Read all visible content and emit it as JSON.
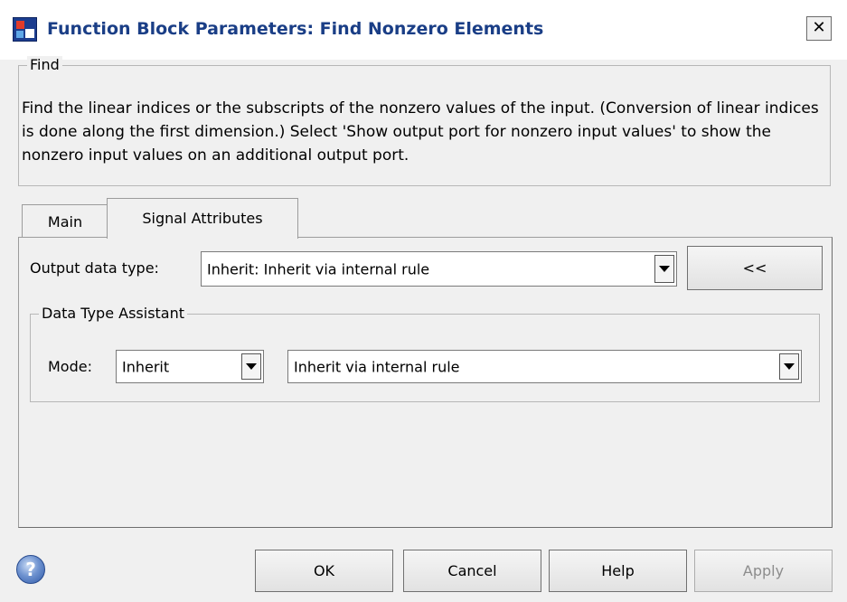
{
  "window": {
    "title": "Function Block Parameters: Find Nonzero Elements",
    "close_glyph": "✕",
    "icon": "simulink-block-icon"
  },
  "block": {
    "group_label": "Find",
    "description": "Find the linear indices or the subscripts of the nonzero values of the input. (Conversion of linear indices is done along the first dimension.) Select 'Show output port for nonzero input values' to show the nonzero input  values on an additional output port."
  },
  "tabs": [
    {
      "label": "Main",
      "active": false
    },
    {
      "label": "Signal Attributes",
      "active": true
    }
  ],
  "signal_attributes": {
    "output_data_type_label": "Output data type:",
    "output_data_type_value": "Inherit: Inherit via internal rule",
    "assistant_toggle_label": "<<",
    "assistant": {
      "group_label": "Data Type Assistant",
      "mode_label": "Mode:",
      "mode_value": "Inherit",
      "rule_value": "Inherit via internal rule"
    }
  },
  "footer": {
    "help_icon_glyph": "?",
    "ok_label": "OK",
    "cancel_label": "Cancel",
    "help_label": "Help",
    "apply_label": "Apply",
    "apply_enabled": false
  }
}
